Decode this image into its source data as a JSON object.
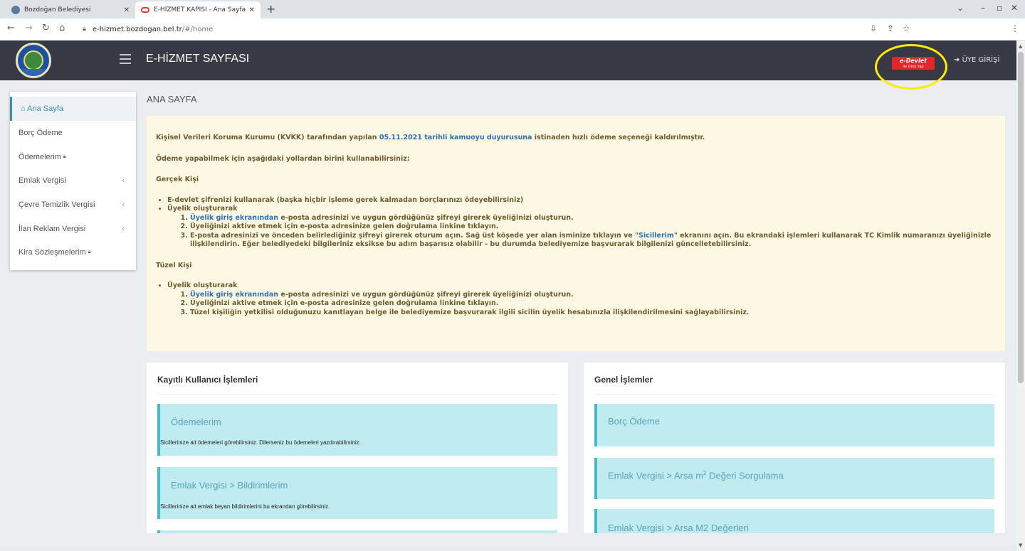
{
  "browser": {
    "tabs": [
      {
        "title": "Bozdoğan Belediyesi",
        "active": false
      },
      {
        "title": "E-HİZMET KAPISI - Ana Sayfa",
        "active": true
      }
    ],
    "url_host": "e-hizmet.bozdogan.bel.tr",
    "url_path": "/#/home"
  },
  "header": {
    "title": "E-HİZMET SAYFASI",
    "edevlet_label": "e-Devlet",
    "edevlet_sub": "ile Giriş Yap",
    "login_label": "ÜYE GİRİŞİ",
    "bar_color": "#373a45",
    "highlight_color": "#ffeb00"
  },
  "sidebar": {
    "items": [
      {
        "label": "Ana Sayfa",
        "icon": "home-icon",
        "active": true
      },
      {
        "label": "Borç Ödeme"
      },
      {
        "label": "Ödemelerim",
        "locked": true
      },
      {
        "label": "Emlak Vergisi",
        "expandable": true
      },
      {
        "label": "Çevre Temizlik Vergisi",
        "expandable": true
      },
      {
        "label": "İlan Reklam Vergisi",
        "expandable": true
      },
      {
        "label": "Kira Sözleşmelerim",
        "locked": true
      }
    ]
  },
  "main": {
    "heading": "ANA SAYFA",
    "notice": {
      "intro_pre": "Kişisel Verileri Koruma Kurumu (KVKK) tarafından yapılan ",
      "intro_link": "05.11.2021 tarihli kamuoyu duyurusuna",
      "intro_post": " istinaden hızlı ödeme seçeneği kaldırılmıştır.",
      "ways": "Ödeme yapabilmek için aşağıdaki yollardan birini kullanabilirsiniz:",
      "real_title": "Gerçek Kişi",
      "real_edevlet": "E-devlet şifrenizi kullanarak (başka hiçbir işleme gerek kalmadan borçlarınızı ödeyebilirsiniz)",
      "real_member": "Üyelik oluşturarak",
      "real_step1_link": "Üyelik giriş ekranından",
      "real_step1_text": " e-posta adresinizi ve uygun gördüğünüz şifreyi girerek üyeliğinizi oluşturun.",
      "real_step2": "Üyeliğinizi aktive etmek için e-posta adresinize gelen doğrulama linkine tıklayın.",
      "real_step3_pre": "E-posta adresinizi ve önceden belirlediğiniz şifreyi girerek oturum açın. Sağ üst köşede yer alan isminize tıklayın ve \"",
      "real_step3_link": "Sicillerim",
      "real_step3_post": "\" ekranını açın. Bu ekrandaki işlemleri kullanarak TC Kimlik numaranızı üyeliğinizle ilişkilendirin. Eğer belediyedeki bilgileriniz eksikse bu adım başarısız olabilir - bu durumda belediyemize başvurarak bilgilenizi güncelletebilirsiniz.",
      "legal_title": "Tüzel Kişi",
      "legal_member": "Üyelik oluşturarak",
      "legal_step1_link": "Üyelik giriş ekranından",
      "legal_step1_text": " e-posta adresinizi ve uygun gördüğünüz şifreyi girerek üyeliğinizi oluşturun.",
      "legal_step2": "Üyeliğinizi aktive etmek için e-posta adresinize gelen doğrulama linkine tıklayın.",
      "legal_step3": "Tüzel kişiliğin yetkilisi olduğunuzu kanıtlayan belge ile belediyemize başvurarak ilgili sicilin üyelik hesabınızla ilişkilendirilmesini sağlayabilirsiniz."
    },
    "registered_panel": {
      "title": "Kayıtlı Kullanıcı İşlemleri",
      "cards": [
        {
          "title": "Ödemelerim",
          "desc": "Sicillerinize ait ödemeleri görebilirsiniz. Dilerseniz bu ödemeleri yazdırabilirsiniz."
        },
        {
          "title": "Emlak Vergisi > Bildirimlerim",
          "desc": "Sicillerinize ait emlak beyan bildirimlerini bu ekrandan görebilirsiniz."
        }
      ]
    },
    "general_panel": {
      "title": "Genel İşlemler",
      "cards": [
        {
          "title": "Borç Ödeme"
        },
        {
          "title_pre": "Emlak Vergisi > Arsa m",
          "title_sup": "2",
          "title_post": " Değeri Sorgulama"
        },
        {
          "title": "Emlak Vergisi > Arsa M2 Değerleri"
        }
      ]
    }
  }
}
